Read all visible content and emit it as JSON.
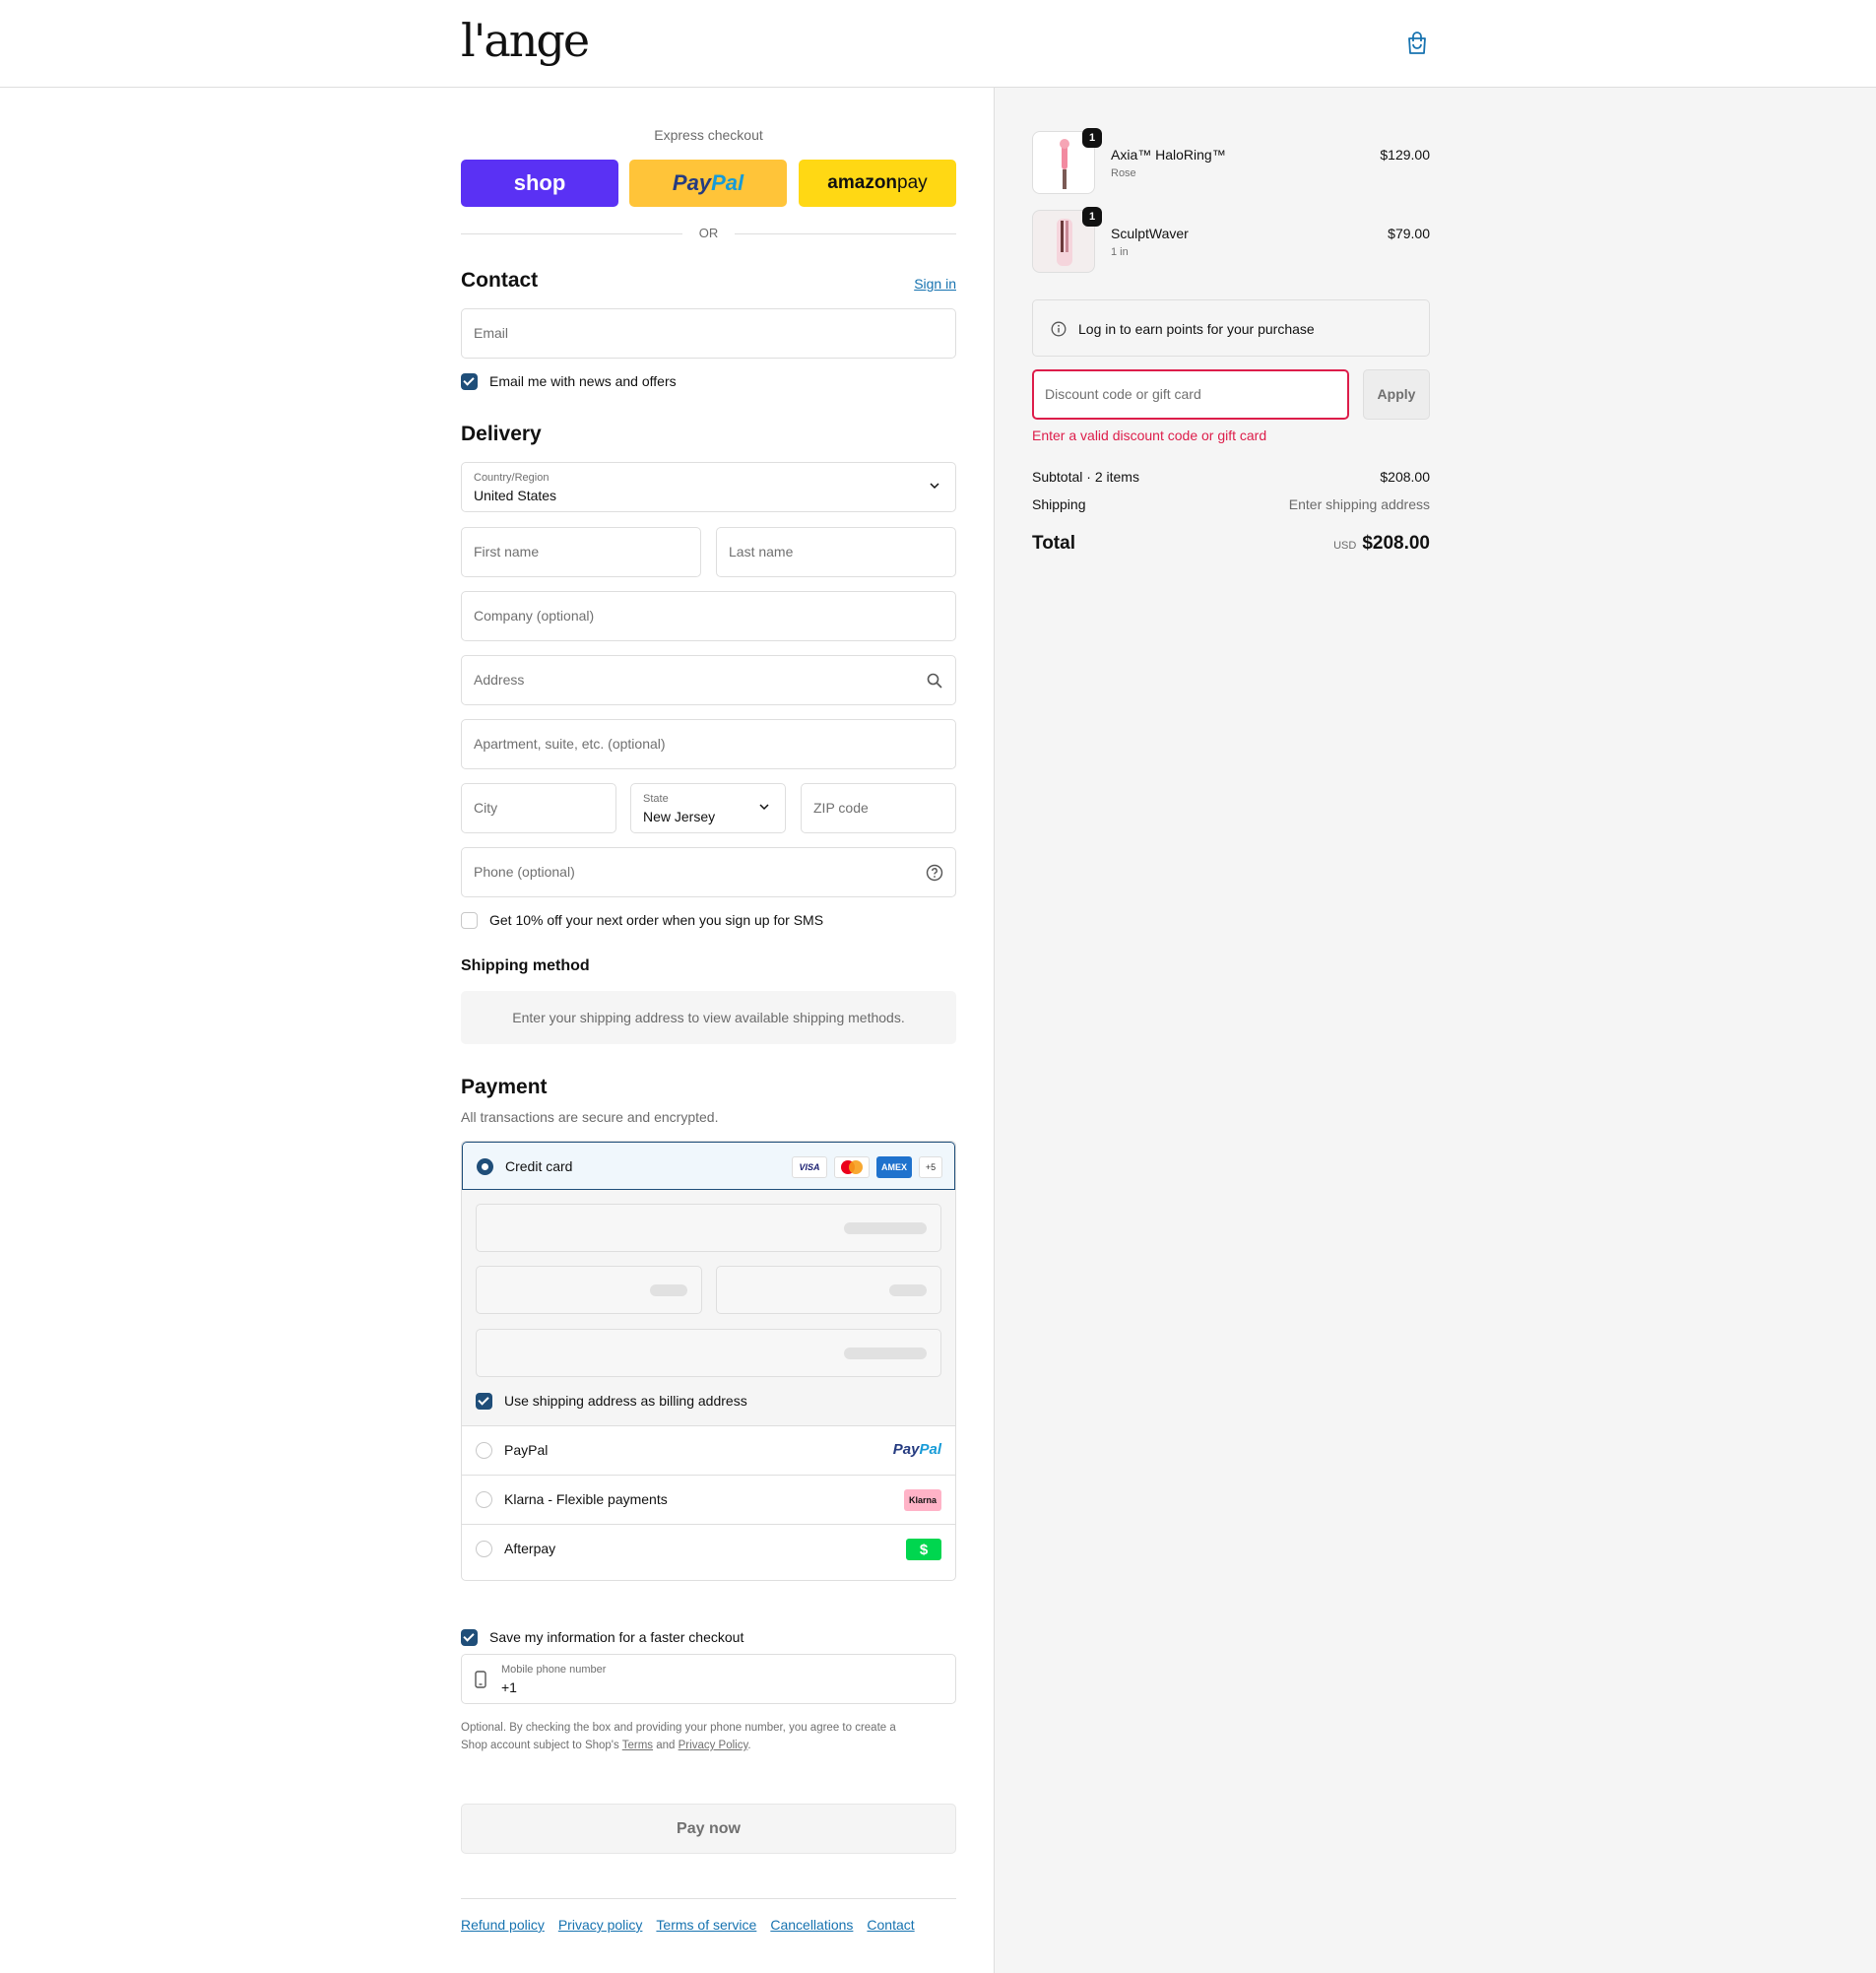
{
  "header": {
    "logo": "l'ange"
  },
  "express": {
    "label": "Express checkout",
    "shop": "shop",
    "paypal_a": "Pay",
    "paypal_b": "Pal",
    "amazon_a": "amazon",
    "amazon_b": " pay",
    "or": "OR"
  },
  "contact": {
    "title": "Contact",
    "signin": "Sign in",
    "email_placeholder": "Email",
    "news_label": "Email me with news and offers"
  },
  "delivery": {
    "title": "Delivery",
    "country_label": "Country/Region",
    "country_value": "United States",
    "first_name": "First name",
    "last_name": "Last name",
    "company": "Company (optional)",
    "address": "Address",
    "apartment": "Apartment, suite, etc. (optional)",
    "city": "City",
    "state_label": "State",
    "state_value": "New Jersey",
    "zip": "ZIP code",
    "phone": "Phone (optional)",
    "sms_label": "Get 10% off your next order when you sign up for SMS"
  },
  "shipping": {
    "title": "Shipping method",
    "message": "Enter your shipping address to view available shipping methods."
  },
  "payment": {
    "title": "Payment",
    "subtitle": "All transactions are secure and encrypted.",
    "credit_card": "Credit card",
    "visa": "VISA",
    "amex": "AMEX",
    "more": "+5",
    "billing_label": "Use shipping address as billing address",
    "paypal": "PayPal",
    "paypal_logo_a": "Pay",
    "paypal_logo_b": "Pal",
    "klarna": "Klarna - Flexible payments",
    "klarna_logo": "Klarna",
    "afterpay": "Afterpay",
    "afterpay_logo": "$"
  },
  "save": {
    "label": "Save my information for a faster checkout",
    "mobile_label": "Mobile phone number",
    "mobile_value": "+1",
    "disclaimer_1": "Optional. By checking the box and providing your phone number, you agree to create a",
    "disclaimer_2": "Shop account subject to Shop's ",
    "terms": "Terms",
    "and": " and ",
    "privacy": "Privacy Policy",
    "period": "."
  },
  "pay_now": "Pay now",
  "footer": [
    "Refund policy",
    "Privacy policy",
    "Terms of service",
    "Cancellations",
    "Contact"
  ],
  "cart": {
    "items": [
      {
        "qty": "1",
        "name": "Axia™ HaloRing™",
        "variant": "Rose",
        "price": "$129.00"
      },
      {
        "qty": "1",
        "name": "SculptWaver",
        "variant": "1 in",
        "price": "$79.00"
      }
    ],
    "points": "Log in to earn points for your purchase",
    "discount_placeholder": "Discount code or gift card",
    "apply": "Apply",
    "error": "Enter a valid discount code or gift card",
    "subtotal_label": "Subtotal · 2 items",
    "subtotal_value": "$208.00",
    "shipping_label": "Shipping",
    "shipping_value": "Enter shipping address",
    "total_label": "Total",
    "currency": "USD",
    "total_value": "$208.00"
  },
  "colors": {
    "accent": "#1f4e79",
    "link": "#1773b0",
    "error": "#dd1d4a",
    "shop": "#5a31f4",
    "paypal": "#ffc439",
    "amazon": "#ffd814"
  }
}
